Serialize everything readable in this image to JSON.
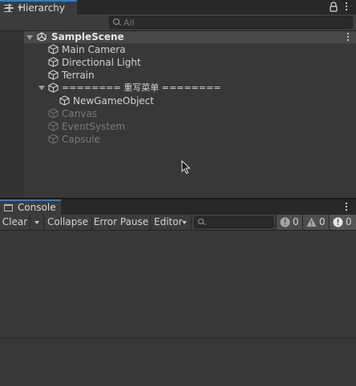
{
  "hierarchy": {
    "tab_label": "Hierarchy",
    "search_placeholder": "All",
    "scene": {
      "name": "SampleScene"
    },
    "items": [
      {
        "label": "Main Camera",
        "active": true
      },
      {
        "label": "Directional Light",
        "active": true
      },
      {
        "label": "Terrain",
        "active": true
      },
      {
        "label": "======== 重写菜单 ========",
        "active": true,
        "expanded": true
      },
      {
        "label": "NewGameObject",
        "active": true,
        "child": true
      },
      {
        "label": "Canvas",
        "active": false
      },
      {
        "label": "EventSystem",
        "active": false
      },
      {
        "label": "Capsule",
        "active": false
      }
    ]
  },
  "console": {
    "tab_label": "Console",
    "toolbar": {
      "clear_label": "Clear",
      "collapse_label": "Collapse",
      "error_pause_label": "Error Pause",
      "editor_label": "Editor",
      "search_value": ""
    },
    "counts": {
      "logs": "0",
      "warnings": "0",
      "errors": "0"
    }
  },
  "colors": {
    "panel_bg": "#383838",
    "tab_accent": "#3a79bb",
    "inactive_text": "#7a7a7a"
  }
}
